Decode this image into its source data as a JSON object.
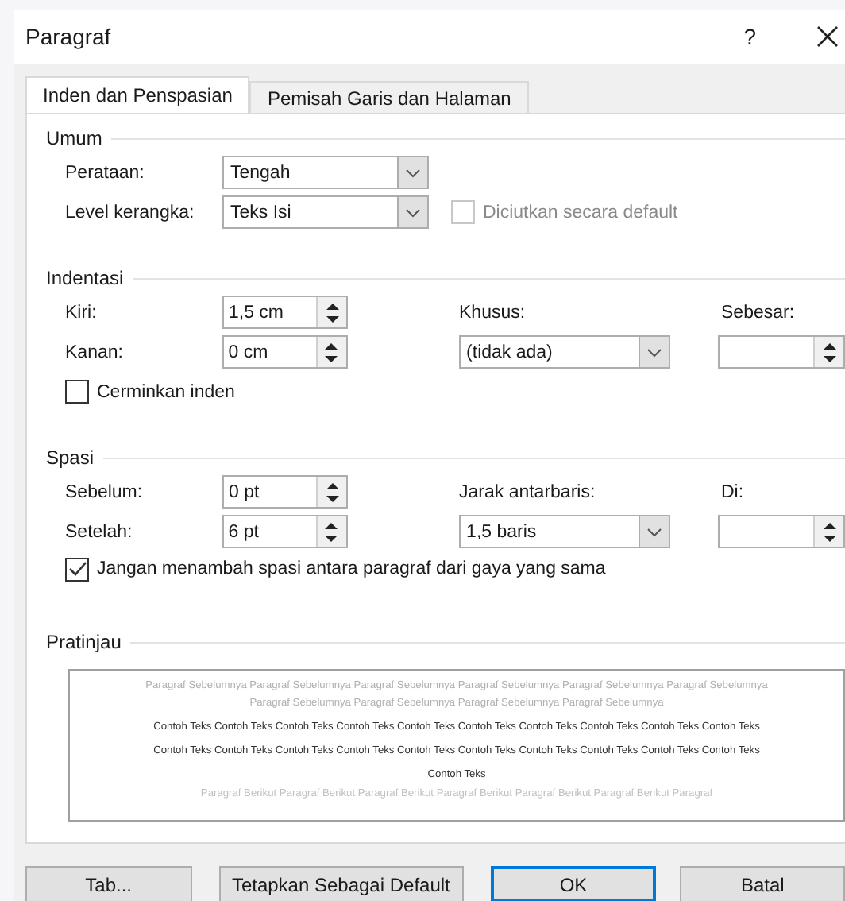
{
  "window": {
    "title": "Paragraf",
    "help": "?"
  },
  "tabs": [
    {
      "label": "Inden dan Penspasian",
      "selected": true
    },
    {
      "label": "Pemisah Garis dan Halaman",
      "selected": false
    }
  ],
  "general": {
    "heading": "Umum",
    "alignment": {
      "label": "Perataan:",
      "value": "Tengah"
    },
    "outline_level": {
      "label": "Level kerangka:",
      "value": "Teks Isi"
    },
    "collapsed": {
      "label": "Diciutkan secara default",
      "checked": false,
      "disabled": true
    }
  },
  "indentation": {
    "heading": "Indentasi",
    "left": {
      "label": "Kiri:",
      "value": "1,5 cm"
    },
    "right": {
      "label": "Kanan:",
      "value": "0 cm"
    },
    "special": {
      "label": "Khusus:",
      "value": "(tidak ada)"
    },
    "by": {
      "label": "Sebesar:"
    },
    "mirror": {
      "label": "Cerminkan inden",
      "checked": false
    }
  },
  "spacing": {
    "heading": "Spasi",
    "before": {
      "label": "Sebelum:",
      "value": "0 pt"
    },
    "after": {
      "label": "Setelah:",
      "value": "6 pt"
    },
    "line_spacing": {
      "label": "Jarak antarbaris:",
      "value": "1,5 baris"
    },
    "at": {
      "label": "Di:"
    },
    "dont_add": {
      "label": "Jangan menambah spasi antara paragraf dari gaya yang sama",
      "checked": true
    }
  },
  "preview": {
    "heading": "Pratinjau",
    "previous_paragraph": "Paragraf Sebelumnya Paragraf Sebelumnya Paragraf Sebelumnya Paragraf Sebelumnya Paragraf Sebelumnya Paragraf Sebelumnya Paragraf Sebelumnya Paragraf Sebelumnya Paragraf Sebelumnya Paragraf Sebelumnya",
    "sample_text": "Contoh Teks Contoh Teks Contoh Teks Contoh Teks Contoh Teks Contoh Teks Contoh Teks Contoh Teks Contoh Teks Contoh Teks Contoh Teks Contoh Teks Contoh Teks Contoh Teks Contoh Teks Contoh Teks Contoh Teks Contoh Teks Contoh Teks Contoh Teks Contoh Teks",
    "next_paragraph": "Paragraf Berikut Paragraf Berikut Paragraf Berikut Paragraf Berikut Paragraf Berikut Paragraf Berikut Paragraf"
  },
  "buttons": [
    {
      "label": "Tab...",
      "default": false
    },
    {
      "label": "Tetapkan Sebagai Default",
      "default": false
    },
    {
      "label": "OK",
      "default": true
    },
    {
      "label": "Batal",
      "default": false
    }
  ]
}
